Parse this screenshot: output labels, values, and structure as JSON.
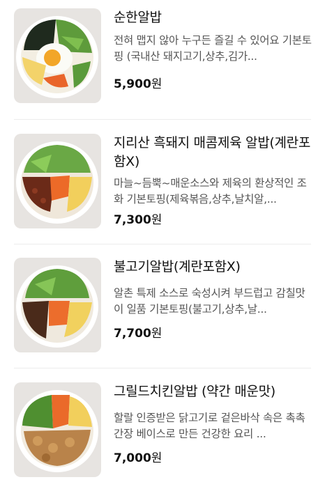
{
  "menu_items": [
    {
      "title": "순한알밥",
      "description": "전혀 맵지 않아 누구든 즐길 수 있어요 기본토핑 (국내산 돼지고기,상추,김가...",
      "price_amount": "5,900",
      "price_unit": "원"
    },
    {
      "title": "지리산 흑돼지 매콤제육 알밥(계란포함X)",
      "description": "마늘~듬뿍~매운소스와 제육의 환상적인 조화 기본토핑(제육볶음,상추,날치알,...",
      "price_amount": "7,300",
      "price_unit": "원"
    },
    {
      "title": "불고기알밥(계란포함X)",
      "description": "알촌 특제 소스로 숙성시켜 부드럽고 감칠맛이 일품 기본토핑(불고기,상추,날...",
      "price_amount": "7,700",
      "price_unit": "원"
    },
    {
      "title": "그릴드치킨알밥 (약간 매운맛)",
      "description": "할랄 인증받은 닭고기로 겉은바삭 속은 촉촉 간장 베이스로 만든 건강한 요리 ...",
      "price_amount": "7,000",
      "price_unit": "원"
    }
  ]
}
